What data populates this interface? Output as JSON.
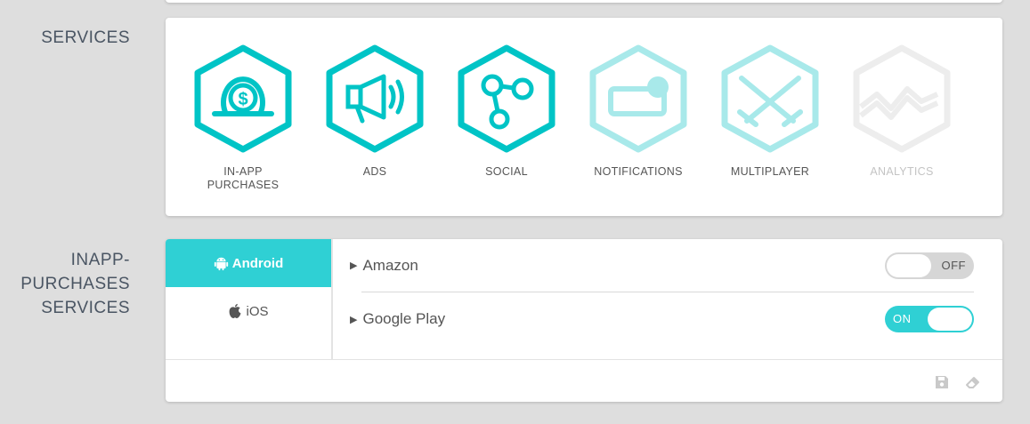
{
  "sections": {
    "services_label": "SERVICES",
    "inapp_label_line1": "INAPP-",
    "inapp_label_line2": "PURCHASES",
    "inapp_label_line3": "SERVICES"
  },
  "services": [
    {
      "label_line1": "IN-APP",
      "label_line2": "PURCHASES",
      "icon": "coin-purchase-icon",
      "state": "active"
    },
    {
      "label_line1": "ADS",
      "label_line2": "",
      "icon": "megaphone-icon",
      "state": "active"
    },
    {
      "label_line1": "SOCIAL",
      "label_line2": "",
      "icon": "share-nodes-icon",
      "state": "active"
    },
    {
      "label_line1": "NOTIFICATIONS",
      "label_line2": "",
      "icon": "notification-icon",
      "state": "faded"
    },
    {
      "label_line1": "MULTIPLAYER",
      "label_line2": "",
      "icon": "crossed-swords-icon",
      "state": "faded"
    },
    {
      "label_line1": "ANALYTICS",
      "label_line2": "",
      "icon": "chart-icon",
      "state": "disabled"
    }
  ],
  "platforms": [
    {
      "label": "Android",
      "icon": "android-icon",
      "active": true
    },
    {
      "label": "iOS",
      "icon": "apple-icon",
      "active": false
    }
  ],
  "providers": [
    {
      "name": "Amazon",
      "toggle": "OFF"
    },
    {
      "name": "Google Play",
      "toggle": "ON"
    }
  ],
  "colors": {
    "accent": "#2fd0d4",
    "icon_active": "#00c4c6",
    "icon_faded": "#a8e9ea",
    "icon_disabled": "#ededed"
  },
  "footer": {
    "save_icon": "save-icon",
    "eraser_icon": "eraser-icon"
  }
}
